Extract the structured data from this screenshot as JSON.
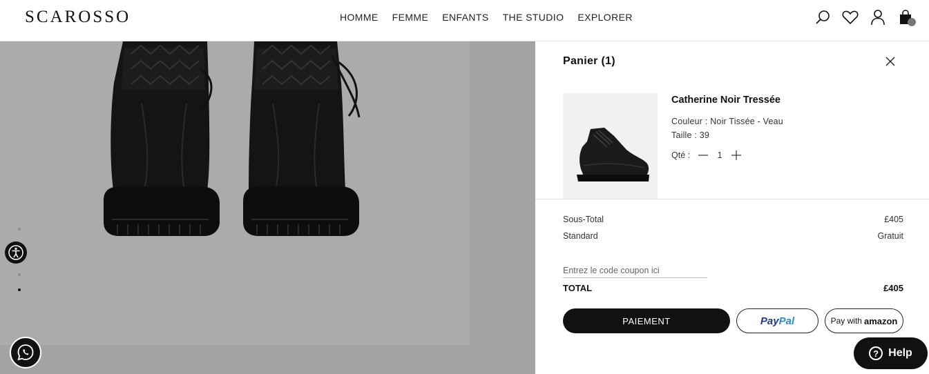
{
  "brand": {
    "logo_text": "SCAROSSO"
  },
  "nav": {
    "items": [
      {
        "label": "HOMME"
      },
      {
        "label": "FEMME"
      },
      {
        "label": "ENFANTS"
      },
      {
        "label": "THE STUDIO"
      },
      {
        "label": "EXPLORER"
      }
    ]
  },
  "header_icons": [
    "search-icon",
    "heart-icon",
    "user-icon",
    "bag-icon"
  ],
  "cart": {
    "title": "Panier (1)",
    "item": {
      "name": "Catherine Noir Tressée",
      "color_line": "Couleur : Noir Tissée - Veau",
      "size_line": "Taille : 39",
      "qty_label": "Qté :",
      "qty_value": "1"
    },
    "subtotal_label": "Sous-Total",
    "subtotal_value": "£405",
    "shipping_label": "Standard",
    "shipping_value": "Gratuit",
    "coupon_placeholder": "Entrez le code coupon ici",
    "total_label": "TOTAL",
    "total_value": "£405",
    "checkout_label": "PAIEMENT",
    "paypal_part1": "Pay",
    "paypal_part2": "Pal",
    "amazon_prefix": "Pay with",
    "amazon_brand": "amazon"
  },
  "help": {
    "label": "Help"
  },
  "colors": {
    "overlay": "#a8a8a8",
    "primary": "#111111",
    "paypal_dark": "#1a3a8c",
    "paypal_light": "#2a8ad6"
  }
}
